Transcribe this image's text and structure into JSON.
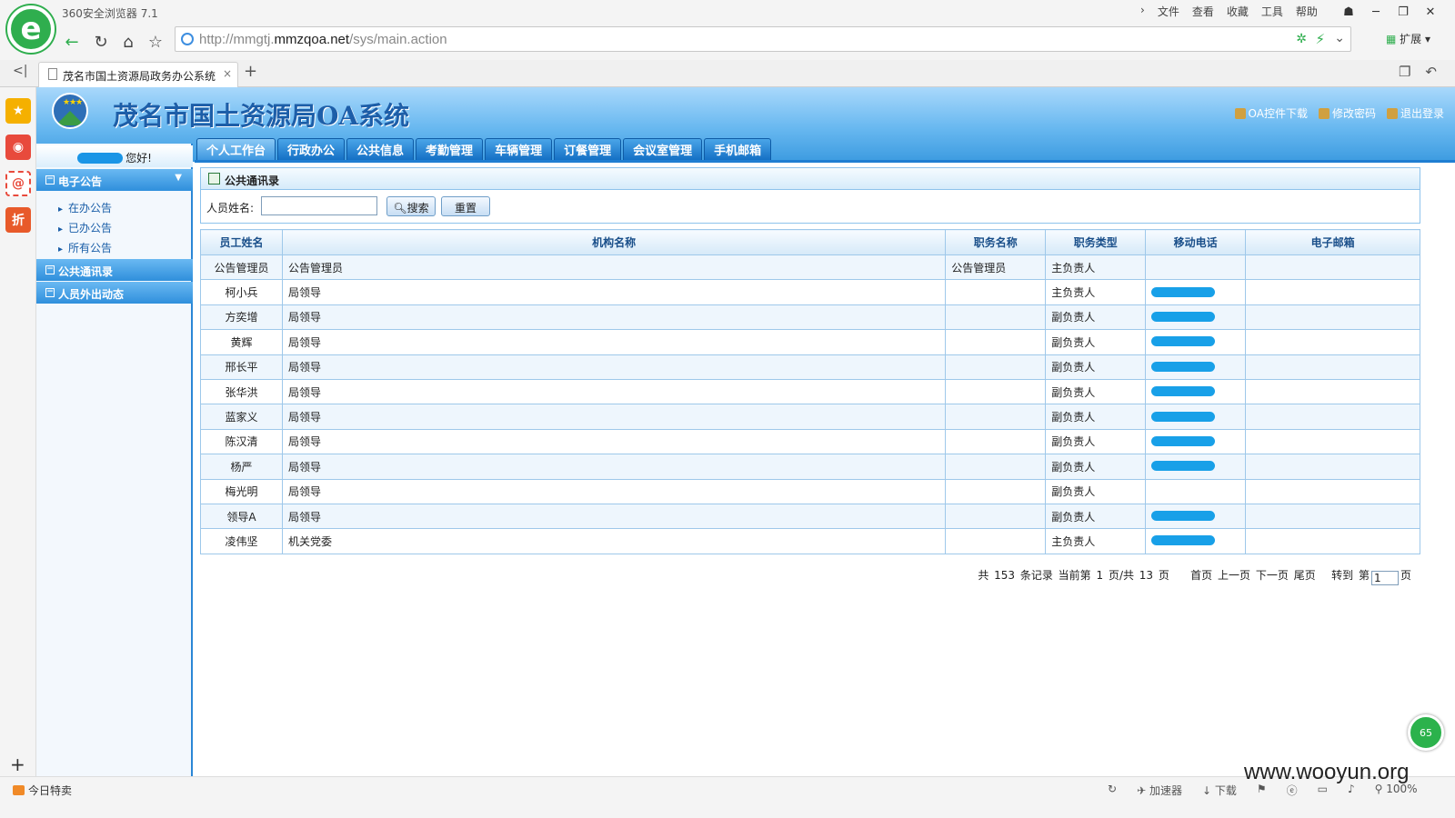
{
  "browser": {
    "app_title": "360安全浏览器 7.1",
    "menu": [
      "文件",
      "查看",
      "收藏",
      "工具",
      "帮助"
    ],
    "url_prefix": "http://mmgtj.",
    "url_domain": "mmzqoa.net",
    "url_suffix": "/sys/main.action",
    "extensions_label": "扩展",
    "tab_title": "茂名市国土资源局政务办公系统",
    "status_left": "今日特卖",
    "status_items": [
      "加速器",
      "下载",
      "100%"
    ]
  },
  "header": {
    "title": "茂名市国土资源局OA系统",
    "links": [
      "OA控件下载",
      "修改密码",
      "退出登录"
    ]
  },
  "nav_tabs": [
    "个人工作台",
    "行政办公",
    "公共信息",
    "考勤管理",
    "车辆管理",
    "订餐管理",
    "会议室管理",
    "手机邮箱"
  ],
  "sidebar": {
    "greeting": "您好!",
    "sections": [
      {
        "label": "电子公告",
        "items": [
          "在办公告",
          "已办公告",
          "所有公告"
        ]
      },
      {
        "label": "公共通讯录"
      },
      {
        "label": "人员外出动态"
      }
    ]
  },
  "panel": {
    "title": "公共通讯录",
    "name_label": "人员姓名:",
    "name_value": "",
    "search_button": "搜索",
    "reset_button": "重置"
  },
  "table": {
    "headers": [
      "员工姓名",
      "机构名称",
      "职务名称",
      "职务类型",
      "移动电话",
      "电子邮箱"
    ],
    "rows": [
      {
        "name": "公告管理员",
        "org": "公告管理员",
        "title": "公告管理员",
        "type": "主负责人",
        "phone_shown": false
      },
      {
        "name": "柯小兵",
        "org": "局领导",
        "title": "",
        "type": "主负责人",
        "phone_shown": true
      },
      {
        "name": "方奕增",
        "org": "局领导",
        "title": "",
        "type": "副负责人",
        "phone_shown": true
      },
      {
        "name": "黄辉",
        "org": "局领导",
        "title": "",
        "type": "副负责人",
        "phone_shown": true
      },
      {
        "name": "邢长平",
        "org": "局领导",
        "title": "",
        "type": "副负责人",
        "phone_shown": true
      },
      {
        "name": "张华洪",
        "org": "局领导",
        "title": "",
        "type": "副负责人",
        "phone_shown": true
      },
      {
        "name": "蓝家义",
        "org": "局领导",
        "title": "",
        "type": "副负责人",
        "phone_shown": true
      },
      {
        "name": "陈汉清",
        "org": "局领导",
        "title": "",
        "type": "副负责人",
        "phone_shown": true
      },
      {
        "name": "杨严",
        "org": "局领导",
        "title": "",
        "type": "副负责人",
        "phone_shown": true
      },
      {
        "name": "梅光明",
        "org": "局领导",
        "title": "",
        "type": "副负责人",
        "phone_shown": false
      },
      {
        "name": "领导A",
        "org": "局领导",
        "title": "",
        "type": "副负责人",
        "phone_shown": true
      },
      {
        "name": "凌伟坚",
        "org": "机关党委",
        "title": "",
        "type": "主负责人",
        "phone_shown": true
      }
    ]
  },
  "pager": {
    "summary": "共 153 条记录 当前第 1 页/共 13 页",
    "first": "首页",
    "prev": "上一页",
    "next": "下一页",
    "last": "尾页",
    "goto_prefix": "转到 第",
    "page_value": "1",
    "goto_suffix": "页"
  },
  "float_badge": "65",
  "watermark": "www.wooyun.org",
  "colors": {
    "accent": "#1f7ed2",
    "redaction": "#18a0e8",
    "logo_green": "#2fae4e"
  }
}
